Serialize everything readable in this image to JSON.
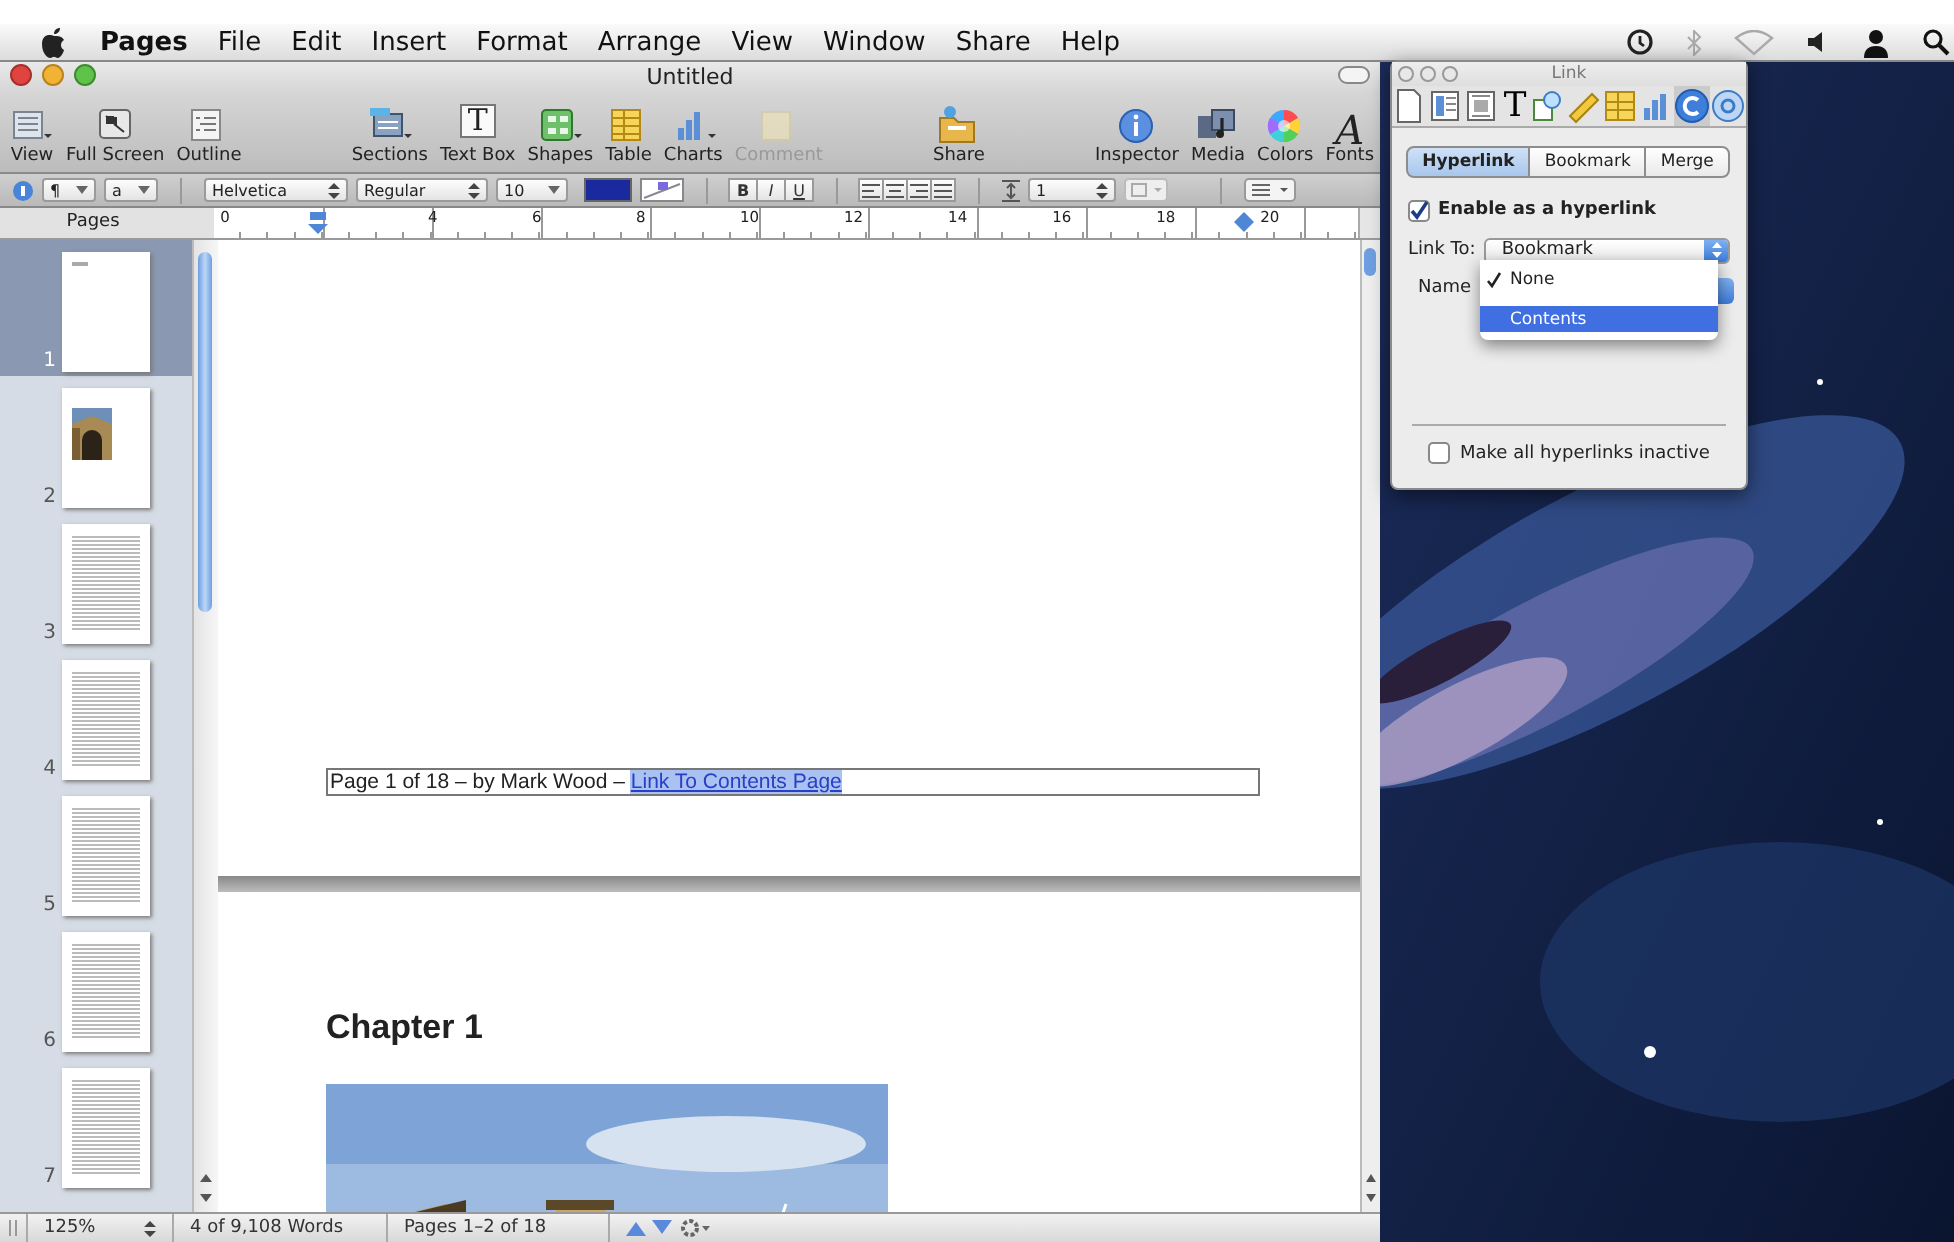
{
  "menu_bar": {
    "app_name": "Pages",
    "items": [
      "File",
      "Edit",
      "Insert",
      "Format",
      "Arrange",
      "View",
      "Window",
      "Share",
      "Help"
    ]
  },
  "window": {
    "title": "Untitled"
  },
  "toolbar": {
    "groups": [
      {
        "items": [
          {
            "label": "View",
            "disabled": false
          },
          {
            "label": "Full Screen",
            "disabled": false
          },
          {
            "label": "Outline",
            "disabled": false
          }
        ]
      },
      {
        "items": [
          {
            "label": "Sections",
            "disabled": false
          },
          {
            "label": "Text Box",
            "glyph": "T",
            "disabled": false
          },
          {
            "label": "Shapes",
            "disabled": false
          },
          {
            "label": "Table",
            "disabled": false
          },
          {
            "label": "Charts",
            "disabled": false
          },
          {
            "label": "Comment",
            "disabled": true
          }
        ]
      },
      {
        "items": [
          {
            "label": "Share",
            "disabled": false
          }
        ]
      },
      {
        "items": [
          {
            "label": "Inspector",
            "disabled": false
          },
          {
            "label": "Media",
            "disabled": false
          },
          {
            "label": "Colors",
            "disabled": false
          },
          {
            "label": "Fonts",
            "glyph": "A",
            "disabled": false
          }
        ]
      }
    ]
  },
  "format_bar": {
    "paragraph_style": "¶",
    "character_style": "a",
    "font": "Helvetica",
    "typeface": "Regular",
    "size": "10",
    "style_buttons": [
      "B",
      "I",
      "U"
    ],
    "line_spacing": "1"
  },
  "ruler": {
    "labels": [
      "0",
      "4",
      "6",
      "8",
      "10",
      "12",
      "14",
      "16",
      "18",
      "20"
    ]
  },
  "sidebar": {
    "title": "Pages",
    "pages": [
      {
        "number": "1",
        "kind": "title",
        "selected": true
      },
      {
        "number": "2",
        "kind": "picture",
        "selected": false
      },
      {
        "number": "3",
        "kind": "text",
        "selected": false
      },
      {
        "number": "4",
        "kind": "text",
        "selected": false
      },
      {
        "number": "5",
        "kind": "text",
        "selected": false
      },
      {
        "number": "6",
        "kind": "text",
        "selected": false
      },
      {
        "number": "7",
        "kind": "text",
        "selected": false
      }
    ]
  },
  "document": {
    "footer": {
      "text": "Page 1 of 18 – by Mark Wood – ",
      "link": "Link To Contents Page",
      "link_selected": true
    },
    "heading": "Chapter 1"
  },
  "status_bar": {
    "zoom": "125%",
    "word_count": "4 of 9,108 Words",
    "page_range": "Pages 1–2 of 18"
  },
  "inspector": {
    "title": "Link",
    "icon_tabs": [
      {
        "selected": false
      },
      {
        "selected": false
      },
      {
        "selected": false
      },
      {
        "glyph": "T",
        "selected": false
      },
      {
        "selected": false
      },
      {
        "selected": false
      },
      {
        "selected": false
      },
      {
        "selected": false
      },
      {
        "selected": true
      },
      {
        "selected": false
      }
    ],
    "tabs": [
      {
        "label": "Hyperlink",
        "selected": true
      },
      {
        "label": "Bookmark",
        "selected": false
      },
      {
        "label": "Merge",
        "selected": false
      }
    ],
    "enable_hyperlink": {
      "label": "Enable as a hyperlink",
      "checked": true
    },
    "link_to": {
      "label": "Link To:",
      "value": "Bookmark"
    },
    "name": {
      "label": "Name"
    },
    "name_menu": [
      {
        "label": "None",
        "checked": true,
        "highlighted": false
      },
      {
        "label": "Contents",
        "checked": false,
        "highlighted": true
      }
    ],
    "inactive_links": {
      "label": "Make all hyperlinks inactive",
      "checked": false
    }
  }
}
